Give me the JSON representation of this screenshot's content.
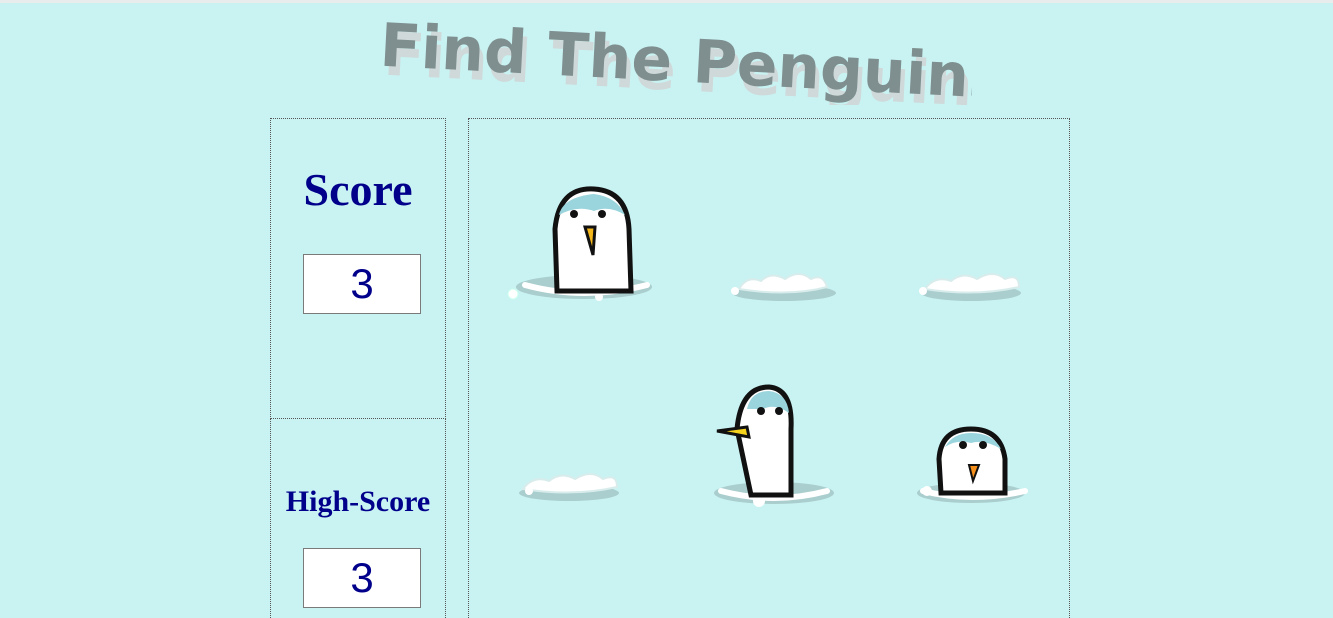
{
  "title": "Find The Penguins",
  "score": {
    "label": "Score",
    "value": "3"
  },
  "high_score": {
    "label": "High-Score",
    "value": "3"
  },
  "board": {
    "holes": [
      {
        "row": 1,
        "col": 1,
        "state": "penguin-front"
      },
      {
        "row": 1,
        "col": 2,
        "state": "empty"
      },
      {
        "row": 1,
        "col": 3,
        "state": "empty"
      },
      {
        "row": 2,
        "col": 1,
        "state": "empty"
      },
      {
        "row": 2,
        "col": 2,
        "state": "penguin-side"
      },
      {
        "row": 2,
        "col": 3,
        "state": "penguin-small"
      }
    ]
  },
  "colors": {
    "background": "#c9f3f3",
    "text": "#00008b",
    "title": "#7f8f8f",
    "snow": "#ffffff",
    "penguin_head": "#9ad4dc",
    "beak": "#f5b81c"
  }
}
